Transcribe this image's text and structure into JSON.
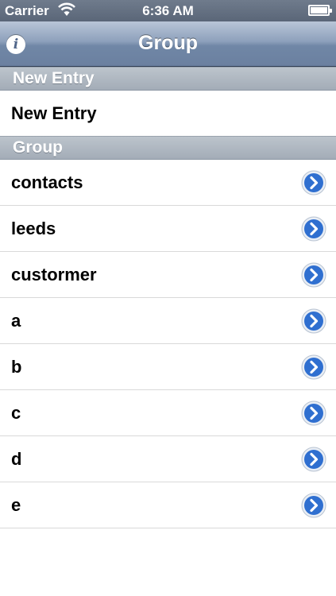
{
  "status_bar": {
    "carrier": "Carrier",
    "time": "6:36 AM"
  },
  "nav_bar": {
    "title": "Group",
    "info_icon": "info-icon"
  },
  "sections": [
    {
      "header": "New Entry",
      "rows": [
        {
          "label": "New Entry"
        }
      ]
    },
    {
      "header": "Group",
      "rows": [
        {
          "label": "contacts"
        },
        {
          "label": "leeds"
        },
        {
          "label": "custormer"
        },
        {
          "label": "a"
        },
        {
          "label": "b"
        },
        {
          "label": "c"
        },
        {
          "label": "d"
        },
        {
          "label": "e"
        }
      ]
    }
  ],
  "colors": {
    "nav_bar": "#7087a6",
    "section_header": "#a3acb7",
    "disclosure": "#2f6fd0"
  }
}
